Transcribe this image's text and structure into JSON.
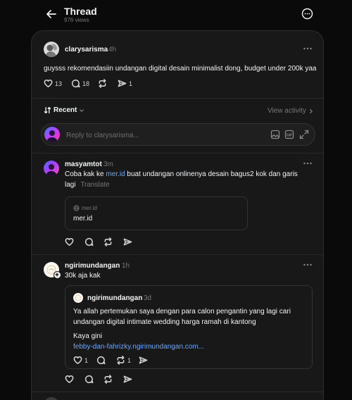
{
  "header": {
    "title": "Thread",
    "views": "976 views"
  },
  "post": {
    "username": "clarysarisma",
    "time": "4h",
    "text": "guysss rekomendasiin undangan digital desain minimalist dong, budget under 200k yaa",
    "likes": "13",
    "replies": "18",
    "shares": "1"
  },
  "sort": {
    "label": "Recent",
    "view_activity": "View activity"
  },
  "reply_box": {
    "placeholder": "Reply to clarysarisma..."
  },
  "comments": [
    {
      "username": "masyamtot",
      "time": "3m",
      "text_before": "Coba kak ke ",
      "link_text": "mer.id",
      "text_after": " buat undangan onlinenya desain bagus2 kok dan garis",
      "text_line2": "lagi",
      "translate": "Translate",
      "preview_domain": "mer.id",
      "preview_title": "mer.id"
    },
    {
      "username": "ngirimundangan",
      "time": "1h",
      "text": "30k aja kak",
      "quote": {
        "username": "ngirimundangan",
        "time": "3d",
        "line1": "Ya allah pertemukan saya dengan para calon pengantin yang lagi cari",
        "line2": "undangan digital intimate wedding harga ramah di kantong",
        "line3": "Kaya gini",
        "link": "febby-dan-fahrizky.ngirimundangan.com...",
        "likes": "1",
        "shares": "1"
      }
    }
  ],
  "colors": {
    "background": "#0a0a0a",
    "card": "#181818",
    "border": "#2d2d2d",
    "link": "#6aa7ff",
    "muted": "#777777"
  }
}
